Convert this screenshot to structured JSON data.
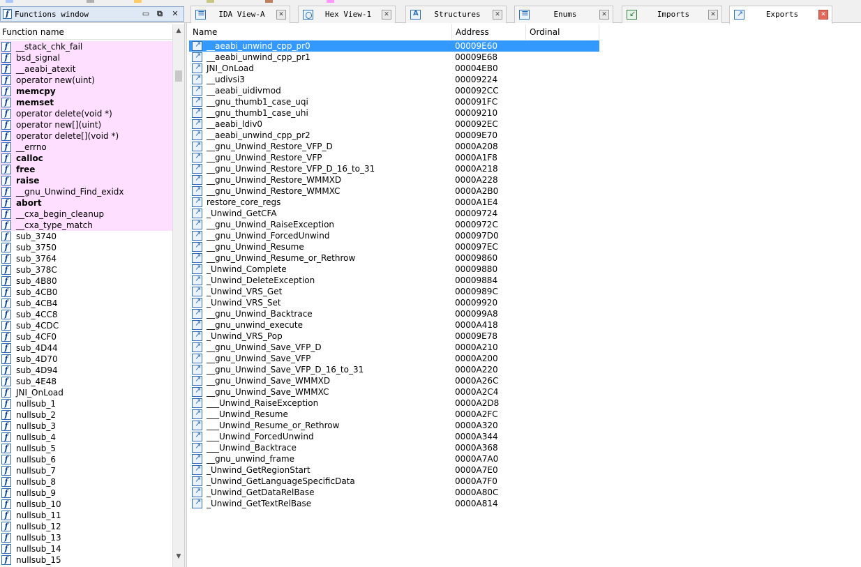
{
  "tabs": [
    {
      "label": "IDA View-A",
      "icon": "ida-view-icon",
      "active": false
    },
    {
      "label": "Hex View-1",
      "icon": "hex-view-icon",
      "active": false
    },
    {
      "label": "Structures",
      "icon": "structures-icon",
      "active": false
    },
    {
      "label": "Enums",
      "icon": "enums-icon",
      "active": false
    },
    {
      "label": "Imports",
      "icon": "imports-icon",
      "active": false
    },
    {
      "label": "Exports",
      "icon": "exports-icon",
      "active": true
    }
  ],
  "functions_window": {
    "title": "Functions window",
    "column_header": "Function name",
    "functions": [
      {
        "name": "__stack_chk_fail",
        "library": true,
        "bold": false
      },
      {
        "name": "bsd_signal",
        "library": true,
        "bold": false
      },
      {
        "name": "__aeabi_atexit",
        "library": true,
        "bold": false
      },
      {
        "name": "operator new(uint)",
        "library": true,
        "bold": false
      },
      {
        "name": "memcpy",
        "library": true,
        "bold": true
      },
      {
        "name": "memset",
        "library": true,
        "bold": true
      },
      {
        "name": "operator delete(void *)",
        "library": true,
        "bold": false
      },
      {
        "name": "operator new[](uint)",
        "library": true,
        "bold": false
      },
      {
        "name": "operator delete[](void *)",
        "library": true,
        "bold": false
      },
      {
        "name": "__errno",
        "library": true,
        "bold": false
      },
      {
        "name": "calloc",
        "library": true,
        "bold": true
      },
      {
        "name": "free",
        "library": true,
        "bold": true
      },
      {
        "name": "raise",
        "library": true,
        "bold": true
      },
      {
        "name": "__gnu_Unwind_Find_exidx",
        "library": true,
        "bold": false
      },
      {
        "name": "abort",
        "library": true,
        "bold": true
      },
      {
        "name": "__cxa_begin_cleanup",
        "library": true,
        "bold": false
      },
      {
        "name": "__cxa_type_match",
        "library": true,
        "bold": false
      },
      {
        "name": "sub_3740",
        "library": false,
        "bold": false
      },
      {
        "name": "sub_3750",
        "library": false,
        "bold": false
      },
      {
        "name": "sub_3764",
        "library": false,
        "bold": false
      },
      {
        "name": "sub_378C",
        "library": false,
        "bold": false
      },
      {
        "name": "sub_4B80",
        "library": false,
        "bold": false
      },
      {
        "name": "sub_4CB0",
        "library": false,
        "bold": false
      },
      {
        "name": "sub_4CB4",
        "library": false,
        "bold": false
      },
      {
        "name": "sub_4CC8",
        "library": false,
        "bold": false
      },
      {
        "name": "sub_4CDC",
        "library": false,
        "bold": false
      },
      {
        "name": "sub_4CF0",
        "library": false,
        "bold": false
      },
      {
        "name": "sub_4D44",
        "library": false,
        "bold": false
      },
      {
        "name": "sub_4D70",
        "library": false,
        "bold": false
      },
      {
        "name": "sub_4D94",
        "library": false,
        "bold": false
      },
      {
        "name": "sub_4E48",
        "library": false,
        "bold": false
      },
      {
        "name": "JNI_OnLoad",
        "library": false,
        "bold": false
      },
      {
        "name": "nullsub_1",
        "library": false,
        "bold": false
      },
      {
        "name": "nullsub_2",
        "library": false,
        "bold": false
      },
      {
        "name": "nullsub_3",
        "library": false,
        "bold": false
      },
      {
        "name": "nullsub_4",
        "library": false,
        "bold": false
      },
      {
        "name": "nullsub_5",
        "library": false,
        "bold": false
      },
      {
        "name": "nullsub_6",
        "library": false,
        "bold": false
      },
      {
        "name": "nullsub_7",
        "library": false,
        "bold": false
      },
      {
        "name": "nullsub_8",
        "library": false,
        "bold": false
      },
      {
        "name": "nullsub_9",
        "library": false,
        "bold": false
      },
      {
        "name": "nullsub_10",
        "library": false,
        "bold": false
      },
      {
        "name": "nullsub_11",
        "library": false,
        "bold": false
      },
      {
        "name": "nullsub_12",
        "library": false,
        "bold": false
      },
      {
        "name": "nullsub_13",
        "library": false,
        "bold": false
      },
      {
        "name": "nullsub_14",
        "library": false,
        "bold": false
      },
      {
        "name": "nullsub_15",
        "library": false,
        "bold": false
      }
    ]
  },
  "exports": {
    "columns": {
      "name": "Name",
      "address": "Address",
      "ordinal": "Ordinal"
    },
    "selected_index": 0,
    "rows": [
      {
        "name": "__aeabi_unwind_cpp_pr0",
        "address": "00009E60",
        "ordinal": ""
      },
      {
        "name": "__aeabi_unwind_cpp_pr1",
        "address": "00009E68",
        "ordinal": ""
      },
      {
        "name": "JNI_OnLoad",
        "address": "00004EB0",
        "ordinal": ""
      },
      {
        "name": "__udivsi3",
        "address": "00009224",
        "ordinal": ""
      },
      {
        "name": "__aeabi_uidivmod",
        "address": "000092CC",
        "ordinal": ""
      },
      {
        "name": "__gnu_thumb1_case_uqi",
        "address": "000091FC",
        "ordinal": ""
      },
      {
        "name": "__gnu_thumb1_case_uhi",
        "address": "00009210",
        "ordinal": ""
      },
      {
        "name": "__aeabi_ldiv0",
        "address": "000092EC",
        "ordinal": ""
      },
      {
        "name": "__aeabi_unwind_cpp_pr2",
        "address": "00009E70",
        "ordinal": ""
      },
      {
        "name": "__gnu_Unwind_Restore_VFP_D",
        "address": "0000A208",
        "ordinal": ""
      },
      {
        "name": "__gnu_Unwind_Restore_VFP",
        "address": "0000A1F8",
        "ordinal": ""
      },
      {
        "name": "__gnu_Unwind_Restore_VFP_D_16_to_31",
        "address": "0000A218",
        "ordinal": ""
      },
      {
        "name": "__gnu_Unwind_Restore_WMMXD",
        "address": "0000A228",
        "ordinal": ""
      },
      {
        "name": "__gnu_Unwind_Restore_WMMXC",
        "address": "0000A2B0",
        "ordinal": ""
      },
      {
        "name": "restore_core_regs",
        "address": "0000A1E4",
        "ordinal": ""
      },
      {
        "name": "_Unwind_GetCFA",
        "address": "00009724",
        "ordinal": ""
      },
      {
        "name": "__gnu_Unwind_RaiseException",
        "address": "0000972C",
        "ordinal": ""
      },
      {
        "name": "__gnu_Unwind_ForcedUnwind",
        "address": "000097D0",
        "ordinal": ""
      },
      {
        "name": "__gnu_Unwind_Resume",
        "address": "000097EC",
        "ordinal": ""
      },
      {
        "name": "__gnu_Unwind_Resume_or_Rethrow",
        "address": "00009860",
        "ordinal": ""
      },
      {
        "name": "_Unwind_Complete",
        "address": "00009880",
        "ordinal": ""
      },
      {
        "name": "_Unwind_DeleteException",
        "address": "00009884",
        "ordinal": ""
      },
      {
        "name": "_Unwind_VRS_Get",
        "address": "0000989C",
        "ordinal": ""
      },
      {
        "name": "_Unwind_VRS_Set",
        "address": "00009920",
        "ordinal": ""
      },
      {
        "name": "__gnu_Unwind_Backtrace",
        "address": "000099A8",
        "ordinal": ""
      },
      {
        "name": "__gnu_unwind_execute",
        "address": "0000A418",
        "ordinal": ""
      },
      {
        "name": "_Unwind_VRS_Pop",
        "address": "00009E78",
        "ordinal": ""
      },
      {
        "name": "__gnu_Unwind_Save_VFP_D",
        "address": "0000A210",
        "ordinal": ""
      },
      {
        "name": "__gnu_Unwind_Save_VFP",
        "address": "0000A200",
        "ordinal": ""
      },
      {
        "name": "__gnu_Unwind_Save_VFP_D_16_to_31",
        "address": "0000A220",
        "ordinal": ""
      },
      {
        "name": "__gnu_Unwind_Save_WMMXD",
        "address": "0000A26C",
        "ordinal": ""
      },
      {
        "name": "__gnu_Unwind_Save_WMMXC",
        "address": "0000A2C4",
        "ordinal": ""
      },
      {
        "name": "___Unwind_RaiseException",
        "address": "0000A2D8",
        "ordinal": ""
      },
      {
        "name": "___Unwind_Resume",
        "address": "0000A2FC",
        "ordinal": ""
      },
      {
        "name": "___Unwind_Resume_or_Rethrow",
        "address": "0000A320",
        "ordinal": ""
      },
      {
        "name": "___Unwind_ForcedUnwind",
        "address": "0000A344",
        "ordinal": ""
      },
      {
        "name": "___Unwind_Backtrace",
        "address": "0000A368",
        "ordinal": ""
      },
      {
        "name": "__gnu_unwind_frame",
        "address": "0000A7A0",
        "ordinal": ""
      },
      {
        "name": "_Unwind_GetRegionStart",
        "address": "0000A7E0",
        "ordinal": ""
      },
      {
        "name": "_Unwind_GetLanguageSpecificData",
        "address": "0000A7F0",
        "ordinal": ""
      },
      {
        "name": "_Unwind_GetDataRelBase",
        "address": "0000A80C",
        "ordinal": ""
      },
      {
        "name": "_Unwind_GetTextRelBase",
        "address": "0000A814",
        "ordinal": ""
      }
    ]
  },
  "colors": {
    "library_function_bg": "#ffdfff",
    "selection_bg": "#3399ff",
    "active_close": "#e36a5a"
  }
}
